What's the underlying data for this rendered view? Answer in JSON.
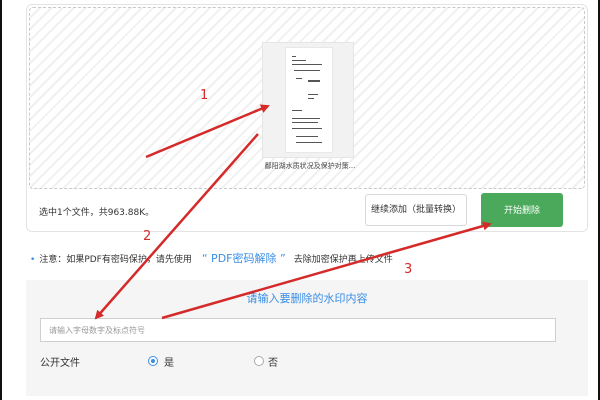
{
  "upload": {
    "file_name": "鄱阳湖水质状况及保护对策...",
    "summary": "选中1个文件，共963.88K。",
    "add_more_label": "继续添加（批量转换）",
    "start_label": "开始删除"
  },
  "notice": {
    "bullet": "•",
    "text_before": "注意：如果PDF有密码保护，请先使用",
    "link": "“ PDF密码解除 ”",
    "text_after": "去除加密保护再上传文件"
  },
  "form": {
    "title": "请输入要删除的水印内容",
    "input_placeholder": "请输入字母数字及标点符号",
    "input_value": "",
    "public_label": "公开文件",
    "options": [
      "是",
      "否"
    ],
    "selected": "是"
  },
  "annotations": {
    "labels": [
      "1",
      "2",
      "3"
    ],
    "color": "#d42a2a"
  },
  "colors": {
    "accent": "#3a8ee6",
    "start_button": "#4aa95b"
  }
}
